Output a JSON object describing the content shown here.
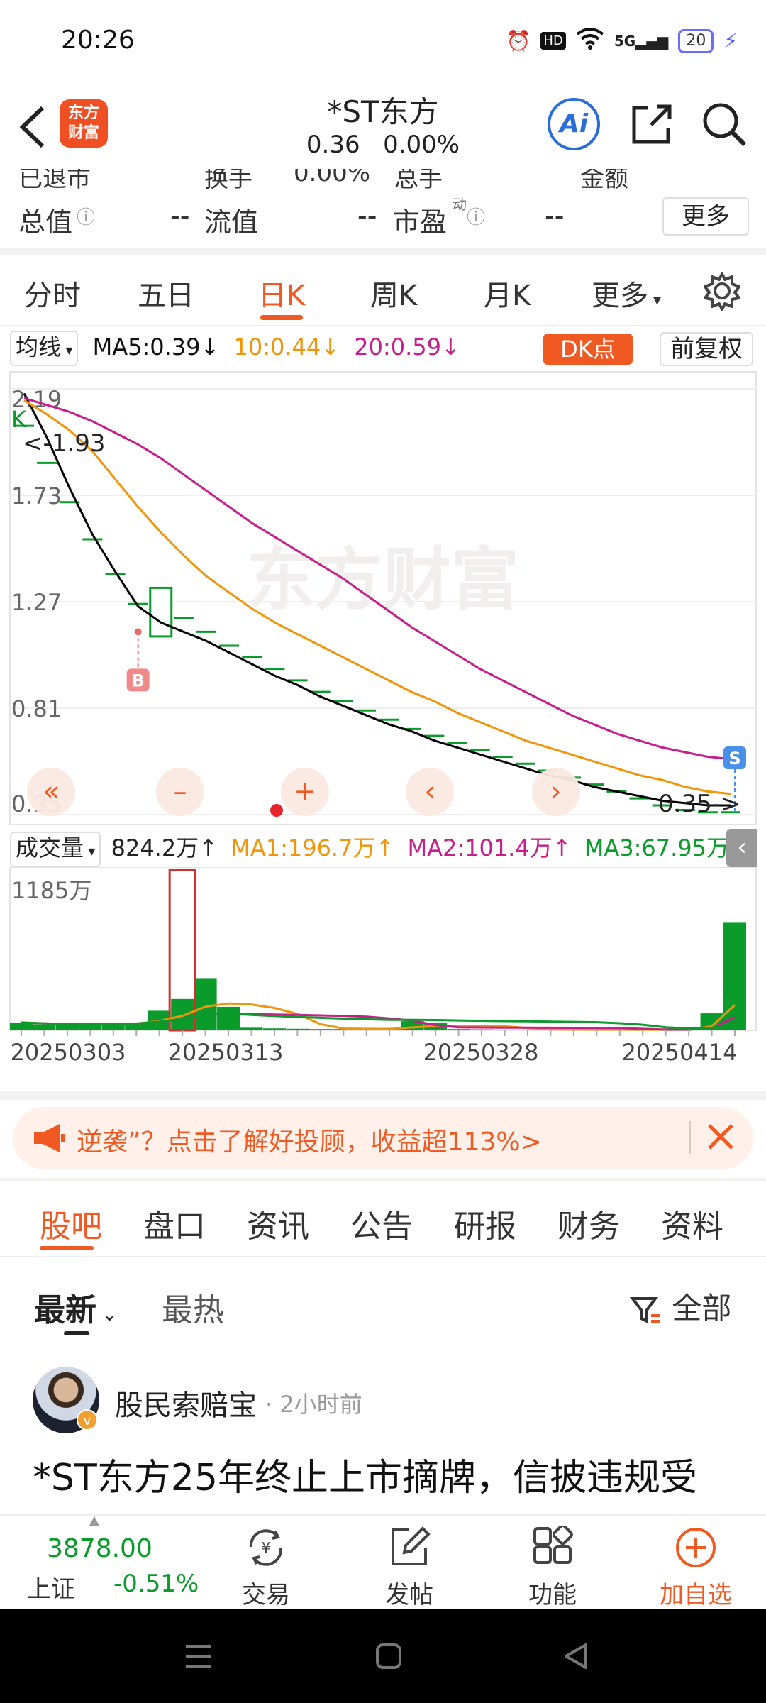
{
  "status_bar": {
    "time": "20:26",
    "battery": "20",
    "network": "5G"
  },
  "header": {
    "logo_line1": "东方",
    "logo_line2": "财富",
    "stock_name": "*ST东方",
    "price": "0.36",
    "change_pct": "0.00%",
    "ai_label": "Ai"
  },
  "indicators": {
    "partial_row": [
      "已退市",
      "换手",
      "0.00%",
      "总手",
      "金额"
    ],
    "total_value_label": "总值",
    "total_value": "--",
    "float_value_label": "流值",
    "float_value": "--",
    "pe_label": "市盈",
    "pe_sup": "动",
    "pe_value": "--",
    "more_label": "更多"
  },
  "period_tabs": [
    "分时",
    "五日",
    "日K",
    "周K",
    "月K",
    "更多"
  ],
  "active_period": "日K",
  "ma_row": {
    "selector": "均线",
    "ma5": "MA5:0.39",
    "ma10": "10:0.44",
    "ma20": "20:0.59",
    "dk_label": "DK点",
    "adjust_label": "前复权"
  },
  "colors": {
    "accent": "#f05a22",
    "ma5": "#000000",
    "ma10": "#f0950a",
    "ma20": "#c81e8c",
    "down": "#0a9b2a",
    "up": "#e03030"
  },
  "chart_data": [
    {
      "type": "candlestick",
      "y_axis_labels": [
        "2.19",
        "1.73",
        "1.27",
        "0.81",
        "0.35"
      ],
      "ylim": [
        0.35,
        2.19
      ],
      "price_tags": {
        "high": "<-1.93",
        "low": "0.35->"
      },
      "markers": {
        "buy": "B",
        "sell": "S",
        "k": "K"
      },
      "watermark": "东方财富",
      "candles_close": [
        2.03,
        1.87,
        1.7,
        1.54,
        1.39,
        1.26,
        1.33,
        1.2,
        1.14,
        1.08,
        1.03,
        0.98,
        0.93,
        0.88,
        0.84,
        0.8,
        0.76,
        0.72,
        0.69,
        0.66,
        0.63,
        0.6,
        0.57,
        0.54,
        0.51,
        0.48,
        0.45,
        0.42,
        0.39,
        0.37,
        0.36,
        0.36
      ],
      "series": [
        {
          "name": "MA5",
          "values": [
            2.17,
            1.98,
            1.76,
            1.56,
            1.4,
            1.25,
            1.18,
            1.14,
            1.1,
            1.05,
            1.0,
            0.95,
            0.91,
            0.86,
            0.82,
            0.78,
            0.74,
            0.71,
            0.67,
            0.64,
            0.61,
            0.58,
            0.55,
            0.52,
            0.5,
            0.47,
            0.45,
            0.43,
            0.41,
            0.4,
            0.39,
            0.39
          ]
        },
        {
          "name": "MA10",
          "values": [
            2.14,
            2.08,
            2.01,
            1.92,
            1.8,
            1.68,
            1.57,
            1.47,
            1.38,
            1.31,
            1.24,
            1.18,
            1.13,
            1.08,
            1.03,
            0.98,
            0.93,
            0.88,
            0.84,
            0.79,
            0.75,
            0.71,
            0.67,
            0.64,
            0.61,
            0.58,
            0.55,
            0.52,
            0.5,
            0.47,
            0.45,
            0.44
          ]
        },
        {
          "name": "MA20",
          "values": [
            2.15,
            2.12,
            2.09,
            2.05,
            2.0,
            1.95,
            1.89,
            1.82,
            1.75,
            1.68,
            1.61,
            1.55,
            1.49,
            1.43,
            1.37,
            1.3,
            1.23,
            1.16,
            1.1,
            1.04,
            0.98,
            0.93,
            0.88,
            0.83,
            0.78,
            0.74,
            0.7,
            0.67,
            0.64,
            0.62,
            0.6,
            0.59
          ]
        }
      ]
    },
    {
      "type": "bar",
      "title": "成交量",
      "value_label": "824.2万",
      "y_axis_label": "1185万",
      "ylim": [
        0,
        1185
      ],
      "series_labels": {
        "ma1": "MA1:196.7万",
        "ma2": "MA2:101.4万",
        "ma3": "MA3:67.95万"
      },
      "values": [
        60,
        45,
        40,
        50,
        55,
        60,
        150,
        240,
        400,
        180,
        20,
        15,
        12,
        10,
        10,
        10,
        12,
        70,
        60,
        10,
        8,
        6,
        6,
        5,
        5,
        5,
        5,
        5,
        5,
        5,
        130,
        824
      ],
      "x_tick_labels": [
        "20250303",
        "20250313",
        "20250328",
        "20250414"
      ]
    }
  ],
  "chart_controls": [
    "«",
    "–",
    "+",
    "‹",
    "›",
    "›"
  ],
  "banner": {
    "text": "逆袭”？点击了解好投顾，收益超113%>"
  },
  "sub_tabs": [
    "股吧",
    "盘口",
    "资讯",
    "公告",
    "研报",
    "财务",
    "资料"
  ],
  "sort": {
    "latest": "最新",
    "hot": "最热",
    "filter": "全部"
  },
  "post": {
    "author": "股民索赔宝",
    "time": "· 2小时前",
    "title": "*ST东方25年终止上市摘牌，信披违规受"
  },
  "bottom_bar": {
    "index_value": "3878.00",
    "index_name": "上证",
    "index_change": "-0.51%",
    "trade": "交易",
    "post": "发帖",
    "functions": "功能",
    "add_watch": "加自选"
  }
}
